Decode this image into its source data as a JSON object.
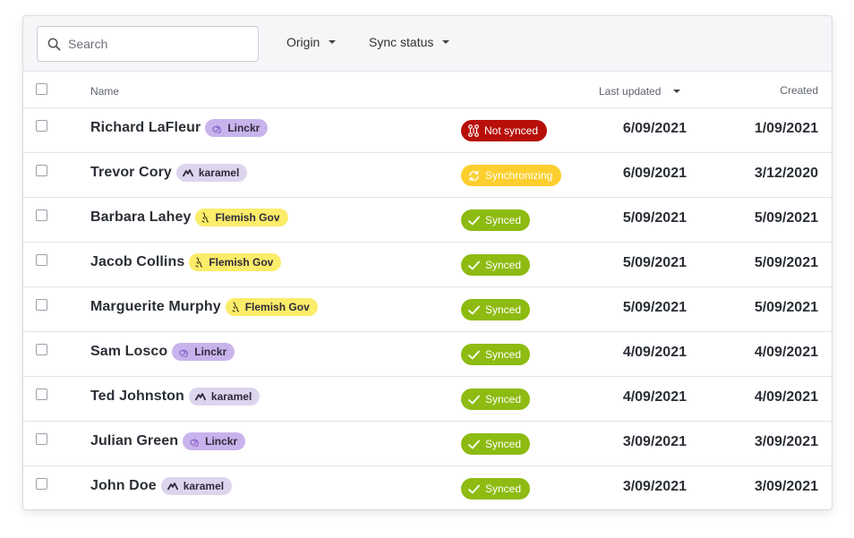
{
  "toolbar": {
    "search_placeholder": "Search",
    "origin_filter_label": "Origin",
    "sync_filter_label": "Sync status"
  },
  "columns": {
    "name": "Name",
    "last_updated": "Last updated",
    "created": "Created"
  },
  "origin_styles": {
    "Linckr": {
      "bg": "#c9b3ec",
      "icon": "spiral-icon"
    },
    "karamel": {
      "bg": "#ddd5ee",
      "icon": "mountain-icon"
    },
    "Flemish Gov": {
      "bg": "#fbec6a",
      "icon": "lion-icon"
    }
  },
  "status_styles": {
    "Not synced": {
      "bg": "#b80f0a",
      "icon": "broken-link-icon"
    },
    "Synchronizing": {
      "bg": "#fccf2e",
      "icon": "refresh-icon"
    },
    "Synced": {
      "bg": "#8dbb11",
      "icon": "checkmark-icon"
    }
  },
  "rows": [
    {
      "name": "Richard LaFleur",
      "origin": "Linckr",
      "status": "Not synced",
      "last_updated": "6/09/2021",
      "created": "1/09/2021"
    },
    {
      "name": "Trevor Cory",
      "origin": "karamel",
      "status": "Synchronizing",
      "last_updated": "6/09/2021",
      "created": "3/12/2020"
    },
    {
      "name": "Barbara Lahey",
      "origin": "Flemish Gov",
      "status": "Synced",
      "last_updated": "5/09/2021",
      "created": "5/09/2021"
    },
    {
      "name": "Jacob Collins",
      "origin": "Flemish Gov",
      "status": "Synced",
      "last_updated": "5/09/2021",
      "created": "5/09/2021"
    },
    {
      "name": "Marguerite Murphy",
      "origin": "Flemish Gov",
      "status": "Synced",
      "last_updated": "5/09/2021",
      "created": "5/09/2021"
    },
    {
      "name": "Sam Losco",
      "origin": "Linckr",
      "status": "Synced",
      "last_updated": "4/09/2021",
      "created": "4/09/2021"
    },
    {
      "name": "Ted Johnston",
      "origin": "karamel",
      "status": "Synced",
      "last_updated": "4/09/2021",
      "created": "4/09/2021"
    },
    {
      "name": "Julian Green",
      "origin": "Linckr",
      "status": "Synced",
      "last_updated": "3/09/2021",
      "created": "3/09/2021"
    },
    {
      "name": "John Doe",
      "origin": "karamel",
      "status": "Synced",
      "last_updated": "3/09/2021",
      "created": "3/09/2021"
    }
  ]
}
